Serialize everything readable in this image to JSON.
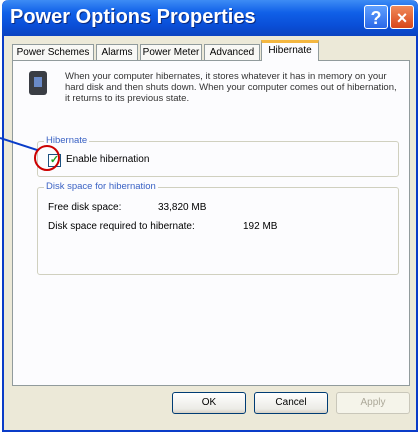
{
  "window": {
    "title": "Power Options Properties",
    "help_icon": "?",
    "close_icon": "×"
  },
  "tabs": [
    "Power Schemes",
    "Alarms",
    "Power Meter",
    "Advanced",
    "Hibernate"
  ],
  "active_tab": "Hibernate",
  "description": "When your computer hibernates, it stores whatever it has in memory on your hard disk and then shuts down. When your computer comes out of hibernation, it returns to its previous state.",
  "hibernate_group": {
    "label": "Hibernate",
    "checkbox_label": "Enable hibernation",
    "checked": true,
    "check_mark": "✓"
  },
  "disk_group": {
    "label": "Disk space for hibernation",
    "free_label": "Free disk space:",
    "free_value": "33,820 MB",
    "required_label": "Disk space required to hibernate:",
    "required_value": "192 MB"
  },
  "buttons": {
    "ok": "OK",
    "cancel": "Cancel",
    "apply": "Apply"
  },
  "colors": {
    "title_bar": "#0a4fd8",
    "highlight_circle": "#cc0000"
  }
}
